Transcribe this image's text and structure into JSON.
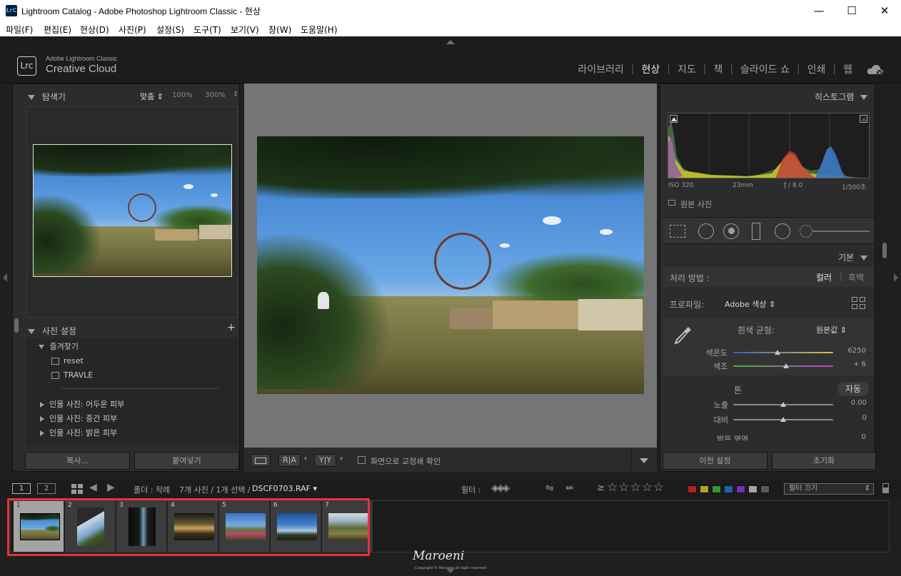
{
  "window": {
    "title": "Lightroom Catalog - Adobe Photoshop Lightroom Classic - 현상",
    "app_icon_text": "LrC",
    "minimize": "—",
    "maximize": "☐",
    "close": "✕"
  },
  "menu": [
    "파일(F)",
    "편집(E)",
    "현상(D)",
    "사진(P)",
    "설정(S)",
    "도구(T)",
    "보기(V)",
    "창(W)",
    "도움말(H)"
  ],
  "identity": {
    "logo": "Lrc",
    "small": "Adobe Lightroom Classic",
    "big": "Creative Cloud"
  },
  "modules": [
    "라이브러리",
    "현상",
    "지도",
    "책",
    "슬라이드 쇼",
    "인쇄",
    "웹"
  ],
  "active_module": "현상",
  "left": {
    "navigator_title": "탐색기",
    "zoom_fit": "맞춤",
    "zoom_100": "100%",
    "zoom_300": "300%",
    "presets_title": "사진 설정",
    "favorites": "즐겨찾기",
    "preset_items": [
      "reset",
      "TRAVLE"
    ],
    "groups": [
      "인물 사진: 어두운 피부",
      "인물 사진: 중간 피부",
      "인물 사진: 밝은 피부"
    ],
    "copy_button": "복사...",
    "paste_button": "붙여넣기"
  },
  "right": {
    "histogram_title": "히스토그램",
    "meta": {
      "iso": "ISO 320",
      "focal": "23mm",
      "aperture": "ƒ / 8.0",
      "shutter": "1/500초"
    },
    "original_photo": "원본 사진",
    "basic_title": "기본",
    "treatment_label": "처리 방법 :",
    "treatment_color": "컬러",
    "treatment_bw": "흑백",
    "profile_label": "프로파일:",
    "profile_value": "Adobe 색상",
    "wb_label": "흰색 균형:",
    "wb_value": "원본값",
    "temp_label": "색온도",
    "temp_value": "6250",
    "tint_label": "색조",
    "tint_value": "+ 6",
    "tone_label": "톤",
    "auto_label": "자동",
    "exposure_label": "노출",
    "exposure_value": "0.00",
    "contrast_label": "대비",
    "contrast_value": "0",
    "highlights_label": "밝은 영역",
    "highlights_value": "0",
    "prev_button": "이전 설정",
    "reset_button": "초기화"
  },
  "toolbar": {
    "proof_label": "화면으로 교정쇄 확인"
  },
  "filmbar": {
    "screen1": "1",
    "screen2": "2",
    "folder_label": "폴더 : 작례",
    "count_label": "7개 사진 / 1개 선택 /",
    "filename": "DSCF0703.RAF",
    "filter_label": "필터 :",
    "filter_off": "필터 끄기",
    "stars_prefix": "≥"
  },
  "thumbnails": [
    {
      "num": "1",
      "selected": true
    },
    {
      "num": "2",
      "selected": false
    },
    {
      "num": "3",
      "selected": false
    },
    {
      "num": "4",
      "selected": false
    },
    {
      "num": "5",
      "selected": false
    },
    {
      "num": "6",
      "selected": false
    },
    {
      "num": "7",
      "selected": false
    }
  ],
  "color_labels": [
    "#b22323",
    "#b2a123",
    "#2e9a2e",
    "#235fb2",
    "#7a2eb2",
    "#a4a4a4",
    "#5a5a5a"
  ],
  "watermark": {
    "text": "Maroeni",
    "sub": "Copyright © Maroeni all right reserved"
  }
}
